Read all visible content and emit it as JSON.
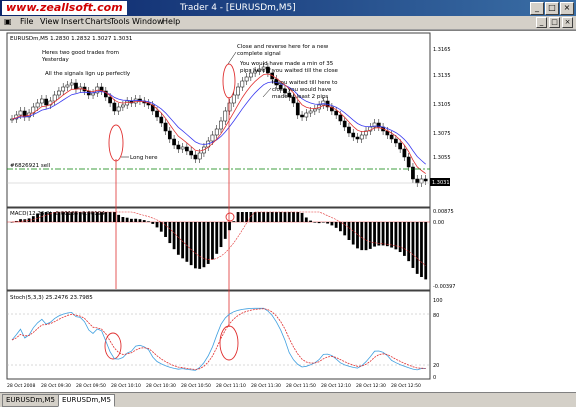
{
  "window": {
    "watermark": "www.zeallsoft.com",
    "title": "Trader 4 - [EURUSDm,M5]",
    "btn_min": "_",
    "btn_max": "□",
    "btn_close": "×"
  },
  "menu": {
    "items": [
      "File",
      "View",
      "Insert",
      "Charts",
      "Tools",
      "Window",
      "Help"
    ],
    "mdi_min": "_",
    "mdi_restore": "□",
    "mdi_close": "×"
  },
  "main_chart": {
    "header": "EURUSDm,M5  1.2830 1.2832 1.3027 1.3031",
    "ind_label": "#6826921 sell",
    "price_labels": [
      "1.3165",
      "1.3135",
      "1.3105",
      "1.3075",
      "1.3055",
      "1.3031"
    ],
    "annotations": {
      "a1": [
        "Heres two good trades from",
        "Yesterday"
      ],
      "a2": "All the signals lign up perfectly",
      "a3": [
        "Close and reverse here for a new",
        "complete signal"
      ],
      "a4": [
        "You would have made a min of 35",
        "pips here if you waited till the close"
      ],
      "a5": [
        "If you waited till here to",
        "close you would have",
        "made at least 2 pips"
      ],
      "a6": "Long here"
    }
  },
  "macd": {
    "header": "MACD(12,26,9) -0.00185 -0.00194",
    "labels": [
      "0.00875",
      "0.00",
      "-0.00397"
    ]
  },
  "stoch": {
    "header": "Stoch(5,3,3) 25.2476 23.7985",
    "labels": [
      "100",
      "80",
      "20",
      "0"
    ]
  },
  "xaxis": {
    "labels": [
      "28 Oct 2008",
      "28 Oct 09:30",
      "28 Oct 09:50",
      "28 Oct 10:10",
      "28 Oct 10:30",
      "28 Oct 10:50",
      "28 Oct 11:10",
      "28 Oct 11:30",
      "28 Oct 11:50",
      "28 Oct 12:10",
      "28 Oct 12:30",
      "28 Oct 12:50"
    ]
  },
  "tabs": [
    "EURUSDm,M5",
    "EURUSDm,M5"
  ]
}
